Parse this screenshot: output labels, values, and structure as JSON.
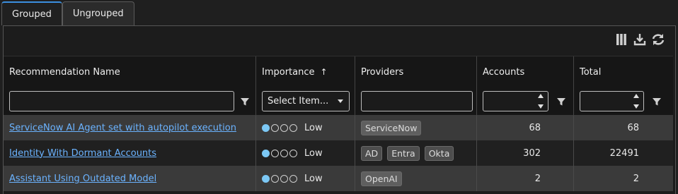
{
  "tabs": [
    {
      "label": "Grouped",
      "active": true
    },
    {
      "label": "Ungrouped",
      "active": false
    }
  ],
  "toolbar": {
    "icons": [
      "columns-icon",
      "download-icon",
      "refresh-icon"
    ]
  },
  "columns": {
    "name": "Recommendation Name",
    "importance": "Importance",
    "importance_sort": "↑",
    "providers": "Providers",
    "accounts": "Accounts",
    "total": "Total"
  },
  "filters": {
    "name_value": "",
    "importance_select": "Select Item...",
    "providers_value": "",
    "accounts_value": "",
    "total_value": ""
  },
  "rows": [
    {
      "name": "ServiceNow AI Agent set with autopilot execution",
      "importance_level": 1,
      "importance": "Low",
      "providers": [
        "ServiceNow"
      ],
      "accounts": "68",
      "total": "68"
    },
    {
      "name": "Identity With Dormant Accounts",
      "importance_level": 1,
      "importance": "Low",
      "providers": [
        "AD",
        "Entra",
        "Okta"
      ],
      "accounts": "302",
      "total": "22491"
    },
    {
      "name": "Assistant Using Outdated Model",
      "importance_level": 1,
      "importance": "Low",
      "providers": [
        "OpenAI"
      ],
      "accounts": "2",
      "total": "2"
    }
  ],
  "colors": {
    "accent": "#3b8fe0",
    "link": "#6bb3ff",
    "importance_dot": "#7cc8f5"
  }
}
